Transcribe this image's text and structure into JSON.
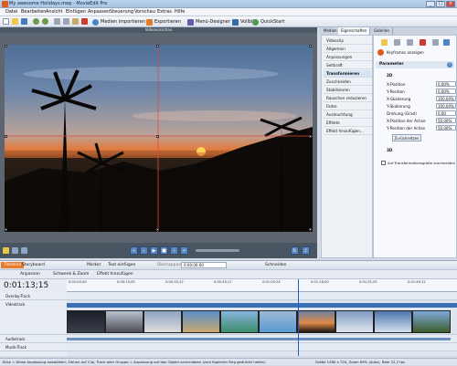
{
  "titlebar": {
    "title": "My awesome Holidays.mep - MovieEdit Pro",
    "minimize": "_",
    "maximize": "□",
    "close": "×"
  },
  "menu": [
    "Datei",
    "Bearbeiten",
    "Ansicht",
    "Einfügen",
    "Anpassen",
    "Steuerung",
    "Vorschau",
    "Extras",
    "Hilfe"
  ],
  "toolbar": {
    "media_import": "Medien importieren",
    "export": "Exportieren",
    "menu_designer": "Menü-Designer",
    "fullscreen": "Vollbild",
    "quickstart": "QuickStart"
  },
  "preview": {
    "header": "Videovorschau"
  },
  "panel_tabs": [
    "Medien",
    "Eigenschaften",
    "Galerien"
  ],
  "sidenav": {
    "items": [
      "Videoclip",
      "Allgemein",
      "Anpassungen",
      "Seitkraft",
      "Transformieren",
      "Zuschneiden",
      "Stabilisieren",
      "Rauschen reduzieren",
      "Farbe",
      "Ausleuchtung",
      "Effekte",
      "Effekt hinzufügen..."
    ]
  },
  "props": {
    "keyframes_label": "Keyframes anzeigen",
    "parameter_header": "Parameter",
    "section_2d": "2D",
    "section_3d": "3D",
    "reset": "Zurücksetzen",
    "checkbox_label": "Auf Transformationsgröße zuschneiden",
    "rows": [
      {
        "label": "X-Position",
        "value": "0,00%"
      },
      {
        "label": "Y-Position",
        "value": "0,00%"
      },
      {
        "label": "X-Skalierung",
        "value": "100,00%"
      },
      {
        "label": "Y-Skalierung",
        "value": "100,00%"
      },
      {
        "label": "Drehung (Grad)",
        "value": "0,00"
      },
      {
        "label": "X-Position der Achse",
        "value": "50,00%"
      },
      {
        "label": "Y-Position der Achse",
        "value": "50,00%"
      }
    ]
  },
  "timeline_bar": {
    "tab_timeline": "Timeline",
    "tab_storyboard": "Storyboard",
    "marker": "Marker",
    "text_insert": "Text einfügen",
    "overlap": "Überlappung",
    "overlap_value": "0:00:00:00",
    "cut": "Schneiden"
  },
  "timeline_bar2": {
    "adjust": "Anpassen",
    "pan_zoom": "Schwenk & Zoom",
    "add_effect": "Effekt hinzufügen"
  },
  "timecode": "0:01:13;15",
  "ruler": [
    "0:00:00;00",
    "0:00:15;05",
    "0:00:30;12",
    "0:00:45;17",
    "0:01:00;24",
    "0:01:16;00",
    "0:01:31;05",
    "0:01:46;12"
  ],
  "tracks": [
    "Overlay-Track",
    "Videotrack",
    "Audiotrack",
    "Musik-Track"
  ],
  "status": "Klick = Diese Anpassung auswählen; Ziehen auf Clip, Track oder Gruppe = Anpassung auf das Objekt verschieben (zum Kopieren Strg gedrückt halten)",
  "status_right": "Größe 1280 x 720, Zoom 69% (Auto), Rate 22,2 fps"
}
